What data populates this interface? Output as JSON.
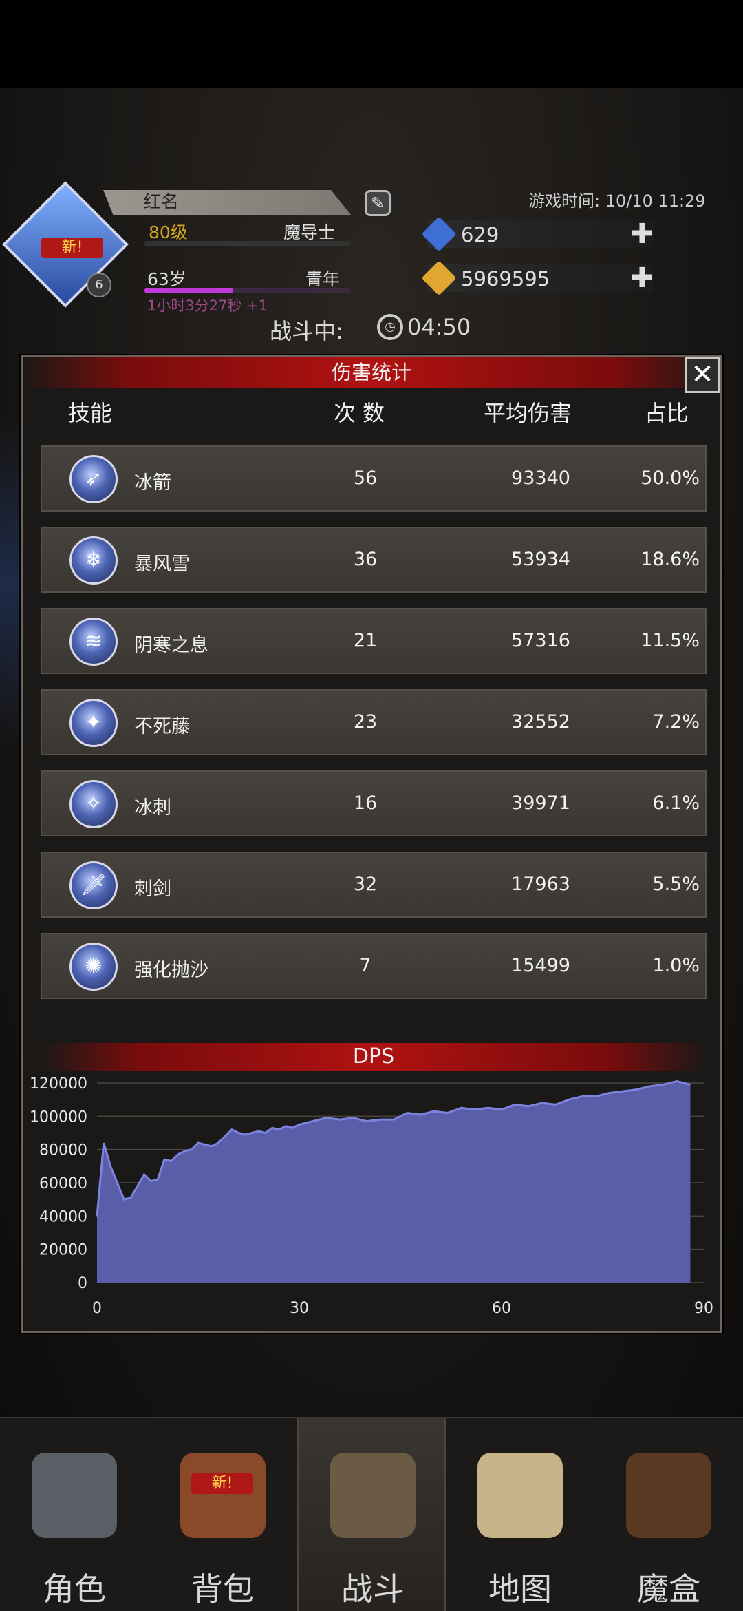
{
  "header": {
    "emblem_badge_new": "新!",
    "emblem_level": "6",
    "name": "红名",
    "level": "80级",
    "class": "魔导士",
    "age": "63岁",
    "life_stage": "青年",
    "age_progress": 0.43,
    "age_timer": "1小时3分27秒 +1",
    "game_time": "游戏时间: 10/10 11:29",
    "gems": "629",
    "gold": "5969595",
    "battle_label": "战斗中:",
    "battle_time": "04:50"
  },
  "panel": {
    "title": "伤害统计",
    "close": "✕",
    "columns": {
      "skill": "技能",
      "count": "次 数",
      "avg": "平均伤害",
      "ratio": "占比"
    },
    "rows": [
      {
        "name": "冰箭",
        "count": "56",
        "avg": "93340",
        "ratio": "50.0%",
        "icon": "ice-arrow-icon"
      },
      {
        "name": "暴风雪",
        "count": "36",
        "avg": "53934",
        "ratio": "18.6%",
        "icon": "blizzard-icon"
      },
      {
        "name": "阴寒之息",
        "count": "21",
        "avg": "57316",
        "ratio": "11.5%",
        "icon": "frost-breath-icon"
      },
      {
        "name": "不死藤",
        "count": "23",
        "avg": "32552",
        "ratio": "7.2%",
        "icon": "undead-vine-icon"
      },
      {
        "name": "冰刺",
        "count": "16",
        "avg": "39971",
        "ratio": "6.1%",
        "icon": "ice-spike-icon"
      },
      {
        "name": "刺剑",
        "count": "32",
        "avg": "17963",
        "ratio": "5.5%",
        "icon": "rapier-icon"
      },
      {
        "name": "强化抛沙",
        "count": "7",
        "avg": "15499",
        "ratio": "1.0%",
        "icon": "sand-throw-icon"
      }
    ],
    "dps_title": "DPS"
  },
  "chart_data": {
    "type": "area",
    "title": "DPS",
    "xlim": [
      0,
      90
    ],
    "ylim": [
      0,
      120000
    ],
    "xticks": [
      "0",
      "30",
      "60",
      "90"
    ],
    "yticks": [
      "0",
      "20000",
      "40000",
      "60000",
      "80000",
      "100000",
      "120000"
    ],
    "grid": true,
    "color": "#5a5ea8",
    "line_color": "#7d84e0",
    "x": [
      0,
      1,
      2,
      3,
      4,
      5,
      6,
      7,
      8,
      9,
      10,
      11,
      12,
      13,
      14,
      15,
      16,
      17,
      18,
      19,
      20,
      21,
      22,
      23,
      24,
      25,
      26,
      27,
      28,
      29,
      30,
      32,
      34,
      36,
      38,
      40,
      42,
      44,
      46,
      48,
      50,
      52,
      54,
      56,
      58,
      60,
      62,
      64,
      66,
      68,
      70,
      72,
      74,
      76,
      78,
      80,
      82,
      84,
      86,
      88
    ],
    "y": [
      40000,
      84000,
      70000,
      60000,
      50000,
      51000,
      58000,
      65000,
      61000,
      62000,
      74000,
      73000,
      77000,
      79000,
      80000,
      84000,
      83000,
      82000,
      84000,
      88000,
      92000,
      90000,
      89000,
      90000,
      91000,
      90000,
      93000,
      92000,
      94000,
      93000,
      95000,
      97000,
      99000,
      98000,
      99000,
      97000,
      98000,
      98000,
      102000,
      101000,
      103000,
      102000,
      105000,
      104000,
      105000,
      104000,
      107000,
      106000,
      108000,
      107000,
      110000,
      112000,
      112000,
      114000,
      115000,
      116000,
      118000,
      119000,
      121000,
      119000
    ]
  },
  "nav": [
    {
      "label": "角色",
      "icon": "helmet-icon"
    },
    {
      "label": "背包",
      "icon": "backpack-icon",
      "badge": "新!"
    },
    {
      "label": "战斗",
      "icon": "sword-shield-icon",
      "active": true
    },
    {
      "label": "地图",
      "icon": "scroll-map-icon"
    },
    {
      "label": "魔盒",
      "icon": "magic-box-icon"
    }
  ]
}
